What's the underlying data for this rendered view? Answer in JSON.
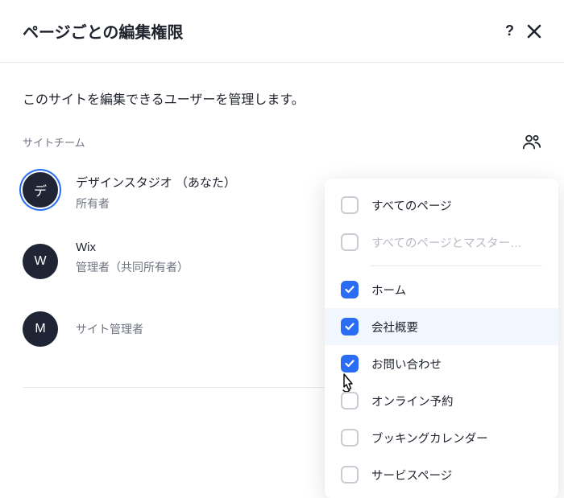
{
  "header": {
    "title": "ページごとの編集権限"
  },
  "subtitle": "このサイトを編集できるユーザーを管理します。",
  "section_label": "サイトチーム",
  "members": [
    {
      "initial": "デ",
      "name": "デザインスタジオ （あなた）",
      "role": "所有者"
    },
    {
      "initial": "W",
      "name": "Wix",
      "role": "管理者（共同所有者）"
    },
    {
      "initial": "M",
      "name": "",
      "role": "サイト管理者"
    }
  ],
  "dropdown": {
    "items": [
      {
        "label": "すべてのページ",
        "checked": false,
        "muted": false
      },
      {
        "label": "すべてのページとマスター…",
        "checked": false,
        "muted": true
      },
      {
        "label": "ホーム",
        "checked": true
      },
      {
        "label": "会社概要",
        "checked": true,
        "highlight": true
      },
      {
        "label": "お問い合わせ",
        "checked": true,
        "cursor": true
      },
      {
        "label": "オンライン予約",
        "checked": false
      },
      {
        "label": "ブッキングカレンダー",
        "checked": false
      },
      {
        "label": "サービスページ",
        "checked": false
      }
    ]
  }
}
